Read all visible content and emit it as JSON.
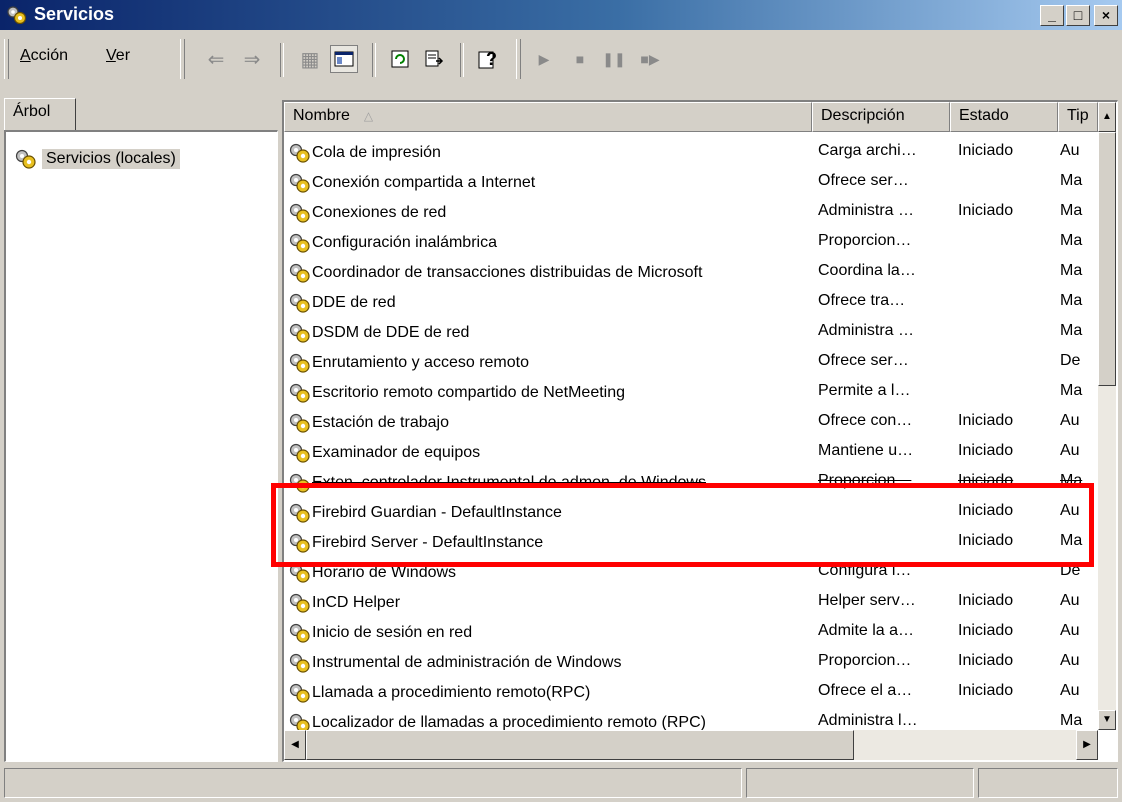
{
  "window": {
    "title": "Servicios",
    "minimize": "_",
    "maximize": "□",
    "close": "×"
  },
  "menu": [
    {
      "label": "Acción",
      "mnemonic": "A",
      "rest": "cción"
    },
    {
      "label": "Ver",
      "mnemonic": "V",
      "rest": "er"
    }
  ],
  "toolbar_icons": [
    "back-arrow-icon",
    "forward-arrow-icon",
    "up-folder-icon",
    "show-hide-tree-icon",
    "refresh-icon",
    "export-list-icon",
    "help-icon",
    "start-service-icon",
    "stop-service-icon",
    "pause-service-icon",
    "restart-service-icon"
  ],
  "tree": {
    "tab_label": "Árbol",
    "root_label": "Servicios (locales)"
  },
  "columns": {
    "name": "Nombre",
    "name_sort": "△",
    "description": "Descripción",
    "status": "Estado",
    "type": "Tip"
  },
  "services": [
    {
      "name": "Cola de impresión",
      "description": "Carga archi…",
      "status": "Iniciado",
      "type": "Au"
    },
    {
      "name": "Conexión compartida a Internet",
      "description": "Ofrece ser…",
      "status": "",
      "type": "Ma"
    },
    {
      "name": "Conexiones de red",
      "description": "Administra …",
      "status": "Iniciado",
      "type": "Ma"
    },
    {
      "name": "Configuración inalámbrica",
      "description": "Proporcion…",
      "status": "",
      "type": "Ma"
    },
    {
      "name": "Coordinador de transacciones distribuidas de Microsoft",
      "description": "Coordina la…",
      "status": "",
      "type": "Ma"
    },
    {
      "name": "DDE de red",
      "description": "Ofrece tra…",
      "status": "",
      "type": "Ma"
    },
    {
      "name": "DSDM de DDE de red",
      "description": "Administra …",
      "status": "",
      "type": "Ma"
    },
    {
      "name": "Enrutamiento y acceso remoto",
      "description": "Ofrece ser…",
      "status": "",
      "type": "De"
    },
    {
      "name": "Escritorio remoto compartido de NetMeeting",
      "description": "Permite a l…",
      "status": "",
      "type": "Ma"
    },
    {
      "name": "Estación de trabajo",
      "description": "Ofrece con…",
      "status": "Iniciado",
      "type": "Au"
    },
    {
      "name": "Examinador de equipos",
      "description": "Mantiene u…",
      "status": "Iniciado",
      "type": "Au"
    },
    {
      "name": "Exten. controlador Instrumental de admon. de Windows",
      "description": "Proporcion…",
      "status": "Iniciado",
      "type": "Ma"
    },
    {
      "name": "Firebird Guardian - DefaultInstance",
      "description": "",
      "status": "Iniciado",
      "type": "Au"
    },
    {
      "name": "Firebird Server - DefaultInstance",
      "description": "",
      "status": "Iniciado",
      "type": "Ma"
    },
    {
      "name": "Horario de Windows",
      "description": "Configura l…",
      "status": "",
      "type": "De"
    },
    {
      "name": "InCD Helper",
      "description": "Helper serv…",
      "status": "Iniciado",
      "type": "Au"
    },
    {
      "name": "Inicio de sesión en red",
      "description": "Admite la a…",
      "status": "Iniciado",
      "type": "Au"
    },
    {
      "name": "Instrumental de administración de Windows",
      "description": "Proporcion…",
      "status": "Iniciado",
      "type": "Au"
    },
    {
      "name": "Llamada a procedimiento remoto(RPC)",
      "description": "Ofrece el a…",
      "status": "Iniciado",
      "type": "Au"
    },
    {
      "name": "Localizador de llamadas a procedimiento remoto (RPC)",
      "description": "Administra l…",
      "status": "",
      "type": "Ma"
    }
  ],
  "scroll_glyphs": {
    "up": "▲",
    "down": "▼",
    "left": "◀",
    "right": "▶"
  },
  "colors": {
    "title_start": "#0a246a",
    "title_end": "#a6caf0",
    "highlight": "#ff0000",
    "chrome": "#d4d0c8"
  },
  "highlight_label": "firebird-services-highlight"
}
